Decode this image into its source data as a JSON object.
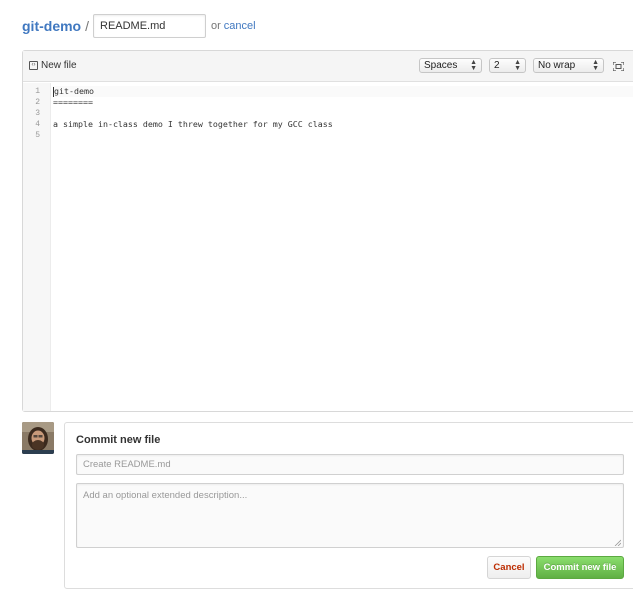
{
  "header": {
    "repo_name": "git-demo",
    "separator": "/",
    "filename_value": "README.md",
    "or_text": "or",
    "cancel_label": "cancel"
  },
  "editor": {
    "new_file_label": "New file",
    "indent_mode": "Spaces",
    "indent_size": "2",
    "wrap_mode": "No wrap",
    "fullscreen_icon": "fullscreen-icon",
    "lines": [
      {
        "num": "1",
        "text": "git-demo"
      },
      {
        "num": "2",
        "text": "========"
      },
      {
        "num": "3",
        "text": ""
      },
      {
        "num": "4",
        "text": "a simple in-class demo I threw together for my GCC class"
      },
      {
        "num": "5",
        "text": ""
      }
    ]
  },
  "commit": {
    "title": "Commit new file",
    "summary_placeholder": "Create README.md",
    "description_placeholder": "Add an optional extended description...",
    "cancel_label": "Cancel",
    "commit_label": "Commit new file"
  },
  "colors": {
    "link": "#4078c0",
    "commit_button": "#60b044",
    "cancel_text": "#bd2c00"
  }
}
